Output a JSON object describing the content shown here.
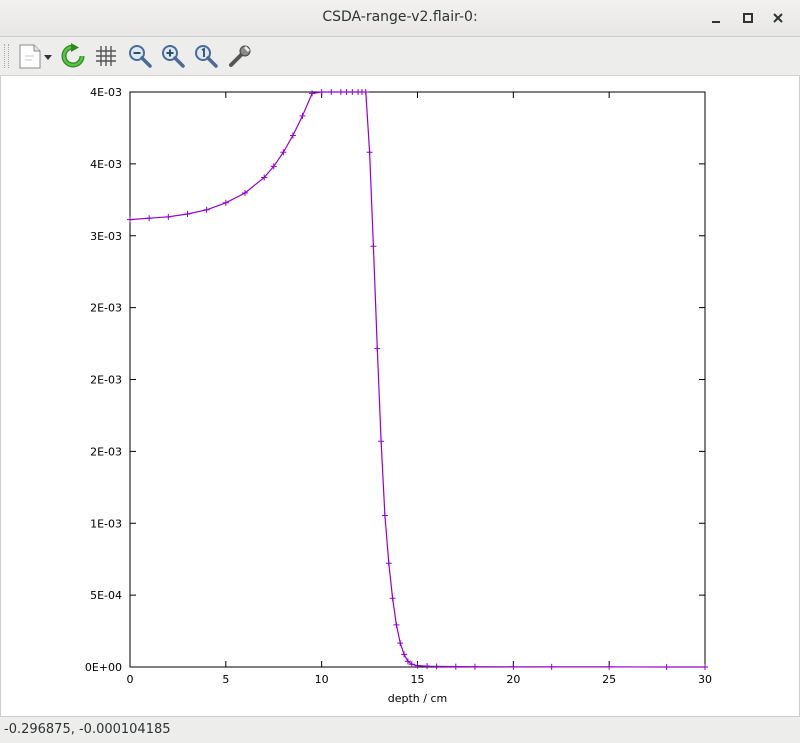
{
  "window": {
    "title": "CSDA-range-v2.flair-0:"
  },
  "toolbar": {
    "tools": [
      {
        "name": "new-document-icon"
      },
      {
        "name": "refresh-icon"
      },
      {
        "name": "grid-icon"
      },
      {
        "name": "zoom-out-icon"
      },
      {
        "name": "zoom-in-icon"
      },
      {
        "name": "zoom-reset-icon"
      },
      {
        "name": "wrench-icon"
      }
    ]
  },
  "status": {
    "coordinates": "-0.296875, -0.000104185"
  },
  "colors": {
    "series": "#9400d3"
  },
  "chart_data": {
    "type": "line",
    "title": "",
    "xlabel": "depth / cm",
    "ylabel": "",
    "xlim": [
      0,
      30
    ],
    "ylim": [
      0,
      0.0041
    ],
    "grid": false,
    "x_ticks": [
      0,
      5,
      10,
      15,
      20,
      25,
      30
    ],
    "x_tick_labels": [
      "0",
      "5",
      "10",
      "15",
      "20",
      "25",
      "30"
    ],
    "y_ticks": [
      0,
      0.0005125,
      0.001025,
      0.0015375,
      0.00205,
      0.0025625,
      0.003075,
      0.0035875,
      0.0041
    ],
    "y_tick_labels": [
      "0E+00",
      "5E-04",
      "1E-03",
      "2E-03",
      "2E-03",
      "2E-03",
      "3E-03",
      "4E-03",
      "4E-03"
    ],
    "series": [
      {
        "color": "#9400d3",
        "marker": "+",
        "x": [
          0,
          1,
          2,
          3,
          4,
          5,
          6,
          7,
          7.5,
          8,
          8.5,
          9,
          9.5,
          10,
          10.5,
          11,
          11.3,
          11.6,
          11.9,
          12.1,
          12.3,
          12.5,
          12.7,
          12.9,
          13.1,
          13.3,
          13.5,
          13.7,
          13.9,
          14.1,
          14.3,
          14.5,
          14.7,
          15,
          15.5,
          16,
          17,
          18,
          20,
          22,
          25,
          28,
          30
        ],
        "y": [
          0.00319,
          0.0032,
          0.00321,
          0.00323,
          0.00326,
          0.00331,
          0.00338,
          0.00349,
          0.00357,
          0.00367,
          0.00379,
          0.00393,
          0.00409,
          0.00424,
          0.00446,
          0.00468,
          0.0048,
          0.00485,
          0.00478,
          0.0046,
          0.0042,
          0.00367,
          0.003,
          0.00227,
          0.00161,
          0.00108,
          0.00074,
          0.00049,
          0.0003,
          0.00017,
          9e-05,
          4e-05,
          2e-05,
          1e-05,
          6e-06,
          4e-06,
          2.5e-06,
          1.8e-06,
          1.2e-06,
          8e-07,
          5e-07,
          3e-07,
          2e-07
        ]
      }
    ]
  }
}
